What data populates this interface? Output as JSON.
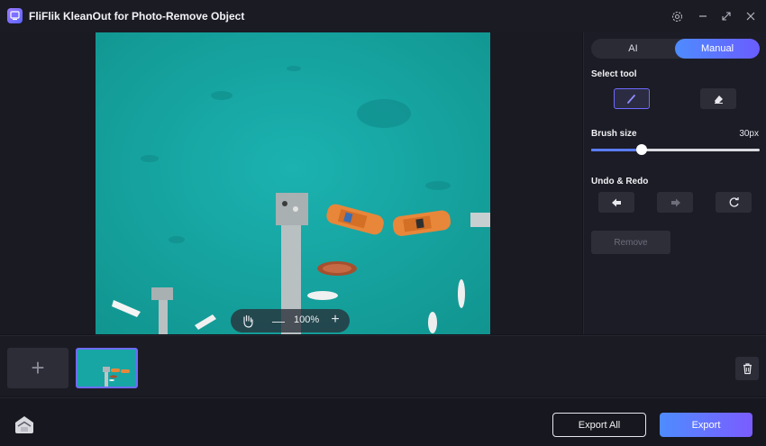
{
  "app": {
    "title": "FliFlik KleanOut for Photo-Remove Object"
  },
  "window_controls": [
    "settings-icon",
    "minimize-icon",
    "maximize-icon",
    "close-icon"
  ],
  "canvas": {
    "zoom_label": "100%",
    "zoom_minus": "—",
    "zoom_plus": "+"
  },
  "panel": {
    "modes": {
      "ai": "AI",
      "manual": "Manual",
      "active": "Manual"
    },
    "select_tool_label": "Select tool",
    "tools": [
      "brush-icon",
      "eraser-icon"
    ],
    "active_tool": "brush",
    "brush_size_label": "Brush size",
    "brush_size_value": "30px",
    "brush_size_fraction": 0.3,
    "undo_redo_label": "Undo & Redo",
    "undo_redo_buttons": [
      "undo-icon",
      "redo-icon",
      "reset-icon"
    ],
    "remove_label": "Remove"
  },
  "thumbnails": {
    "add_label": "+",
    "count_selected": 1
  },
  "footer": {
    "export_all_label": "Export All",
    "export_label": "Export"
  },
  "colors": {
    "accent": "#6a5cff",
    "accent_blue": "#4e8cff",
    "background": "#14141c",
    "water": "#17a6a4"
  }
}
